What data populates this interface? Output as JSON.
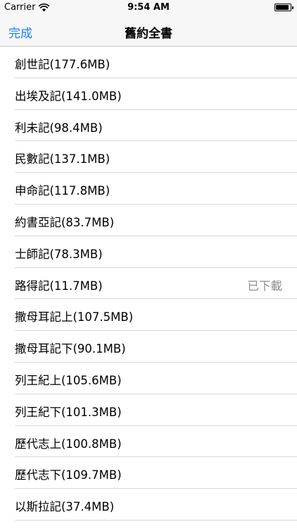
{
  "status_bar": {
    "carrier": "Carrier",
    "time": "9:54 AM",
    "wifi_icon": "wifi-icon",
    "battery_icon": "battery-icon",
    "battery_level": 0.9
  },
  "nav": {
    "done_label": "完成",
    "title": "舊約全書"
  },
  "colors": {
    "accent": "#1a7cf6",
    "status_text": "#8e8e93",
    "separator": "#d9d9de",
    "bar_background": "#f7f7f7"
  },
  "books": [
    {
      "title": "創世記(177.6MB)",
      "status": ""
    },
    {
      "title": "出埃及記(141.0MB)",
      "status": ""
    },
    {
      "title": "利未記(98.4MB)",
      "status": ""
    },
    {
      "title": "民數記(137.1MB)",
      "status": ""
    },
    {
      "title": "申命記(117.8MB)",
      "status": ""
    },
    {
      "title": "約書亞記(83.7MB)",
      "status": ""
    },
    {
      "title": "士師記(78.3MB)",
      "status": ""
    },
    {
      "title": "路得記(11.7MB)",
      "status": "已下載"
    },
    {
      "title": "撒母耳記上(107.5MB)",
      "status": ""
    },
    {
      "title": "撒母耳記下(90.1MB)",
      "status": ""
    },
    {
      "title": "列王紀上(105.6MB)",
      "status": ""
    },
    {
      "title": "列王紀下(101.3MB)",
      "status": ""
    },
    {
      "title": "歷代志上(100.8MB)",
      "status": ""
    },
    {
      "title": "歷代志下(109.7MB)",
      "status": ""
    },
    {
      "title": "以斯拉記(37.4MB)",
      "status": ""
    }
  ]
}
